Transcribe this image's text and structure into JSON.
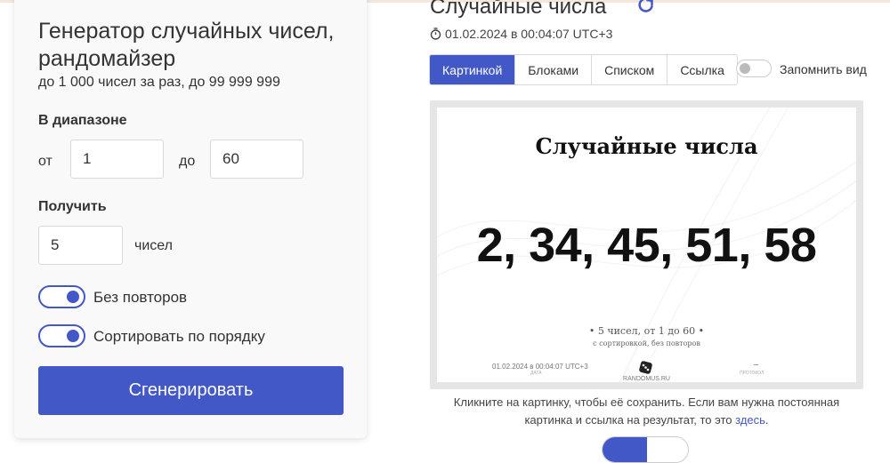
{
  "generator": {
    "title": "Генератор случайных чисел, рандомайзер",
    "subtitle": "до 1 000 чисел за раз, до 99 999 999",
    "range_label": "В диапазоне",
    "from_label": "от",
    "from_value": "1",
    "to_label": "до",
    "to_value": "60",
    "get_label": "Получить",
    "count_value": "5",
    "count_unit": "чисел",
    "no_repeat_label": "Без повторов",
    "no_repeat_on": true,
    "sort_label": "Сортировать по порядку",
    "sort_on": true,
    "generate_button": "Сгенерировать"
  },
  "result": {
    "title": "Случайные числа",
    "timestamp": "01.02.2024 в 00:04:07 UTC+3",
    "tabs": [
      {
        "label": "Картинкой",
        "active": true
      },
      {
        "label": "Блоками",
        "active": false
      },
      {
        "label": "Списком",
        "active": false
      },
      {
        "label": "Ссылка",
        "active": false
      }
    ],
    "remember_label": "Запомнить вид",
    "remember_on": false,
    "image": {
      "title": "Случайные числа",
      "numbers": "2, 34, 45, 51, 58",
      "summary": "5 чисел, от 1 до 60",
      "description": "с сортировкой, без повторов",
      "date": "01.02.2024 в 00:04:07 UTC+3",
      "date_caption": "ДАТА",
      "site": "RANDOMUS.RU",
      "protocol_caption": "ПРОТОКОЛ"
    },
    "caption_text": "Кликните на картинку, чтобы её сохранить. Если вам нужна постоянная картинка и ссылка на результат, то это ",
    "caption_link": "здесь",
    "caption_end": "."
  },
  "colors": {
    "accent": "#4358c7",
    "card_bg": "#f9f9f9",
    "frame_bg": "#e6e6e6"
  },
  "icons": [
    "refresh-icon",
    "stopwatch-icon",
    "dice-icon"
  ]
}
